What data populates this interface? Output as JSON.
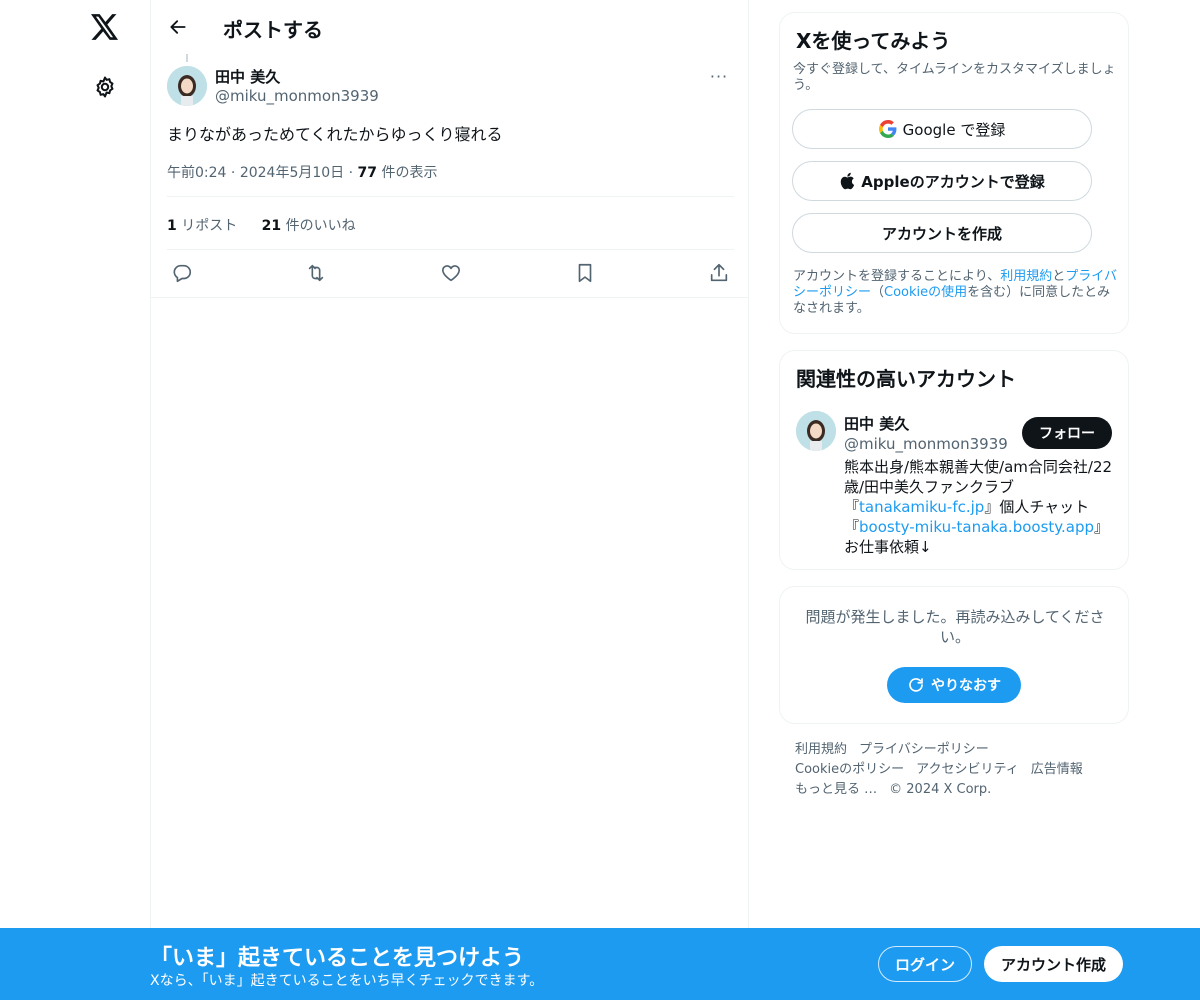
{
  "nav": {
    "logo_icon": "x-logo-icon",
    "settings_icon": "gear-icon"
  },
  "header": {
    "title": "ポストする",
    "back_icon": "arrow-left-icon"
  },
  "post": {
    "author_name": "田中 美久",
    "author_handle": "@miku_monmon3939",
    "more_label": "···",
    "text": "まりながあっためてくれたからゆっくり寝れる",
    "time": "午前0:24",
    "date": "2024年5月10日",
    "views_count": "77",
    "views_label": "件の表示",
    "reposts_count": "1",
    "reposts_label": "リポスト",
    "likes_count": "21",
    "likes_label": "件のいいね"
  },
  "signup": {
    "title": "Xを使ってみよう",
    "subtitle": "今すぐ登録して、タイムラインをカスタマイズしましょう。",
    "google_label": "Google で登録",
    "apple_label": "Appleのアカウントで登録",
    "create_label": "アカウントを作成",
    "legal_prefix": "アカウントを登録することにより、",
    "terms_link": "利用規約",
    "legal_and": "と",
    "privacy_link": "プライバシーポリシー",
    "legal_paren_open": "（",
    "cookie_link": "Cookieの使用",
    "legal_suffix": "を含む）に同意したとみなされます。"
  },
  "related": {
    "title": "関連性の高いアカウント",
    "name": "田中 美久",
    "handle": "@miku_monmon3939",
    "follow_label": "フォロー",
    "bio_1": "熊本出身/熊本親善大使/am合同会社/22歳/田中美久ファンクラブ『",
    "bio_link_1": "tanakamiku-fc.jp",
    "bio_2": "』個人チャット『",
    "bio_link_2": "boosty-miku-tanaka.boosty.app",
    "bio_3": "』お仕事依頼↓"
  },
  "error": {
    "text": "問題が発生しました。再読み込みしてください。",
    "retry_label": "やりなおす"
  },
  "footer": {
    "terms": "利用規約",
    "privacy": "プライバシーポリシー",
    "cookie": "Cookieのポリシー",
    "accessibility": "アクセシビリティ",
    "ads": "広告情報",
    "more": "もっと見る …",
    "copyright": "© 2024 X Corp."
  },
  "banner": {
    "title": "「いま」起きていることを見つけよう",
    "subtitle": "Xなら、「いま」起きていることをいち早くチェックできます。",
    "login_label": "ログイン",
    "create_label": "アカウント作成"
  },
  "colors": {
    "accent": "#1d9bf0",
    "text": "#0f1419",
    "muted": "#536471",
    "border": "#eff3f4"
  }
}
